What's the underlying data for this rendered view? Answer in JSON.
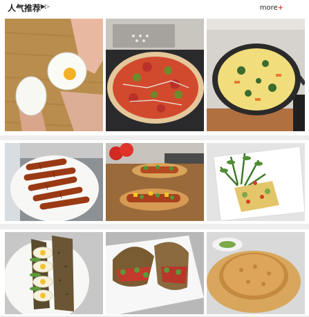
{
  "header": {
    "title": "人气推荐",
    "title_arrows": "▶▷",
    "more_label": "more",
    "more_plus": "+"
  },
  "tiles": [
    {
      "icon": "boiled-egg-photo"
    },
    {
      "icon": "pizza-photo"
    },
    {
      "icon": "pasta-pan-photo"
    },
    {
      "icon": "sausages-photo"
    },
    {
      "icon": "hotdogs-photo"
    },
    {
      "icon": "salad-quiche-photo"
    },
    {
      "icon": "egg-sandwich-photo"
    },
    {
      "icon": "sandwich-plate-photo"
    },
    {
      "icon": "cheese-pie-photo"
    }
  ],
  "colors": {
    "accent": "#e23b2e",
    "background": "#eeeeee"
  }
}
